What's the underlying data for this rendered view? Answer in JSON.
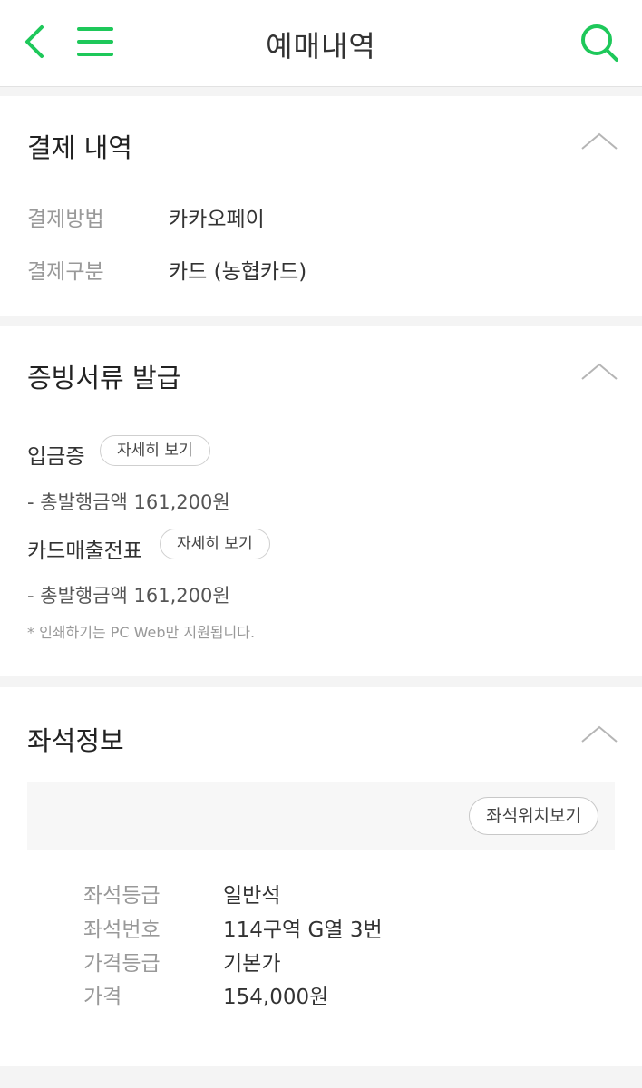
{
  "header": {
    "title": "예매내역",
    "back_icon": "chevron-left-icon",
    "menu_icon": "hamburger-menu-icon",
    "search_icon": "search-icon",
    "accent_color": "#1ec85a"
  },
  "payment": {
    "title": "결제 내역",
    "rows": [
      {
        "label": "결제방법",
        "value": "카카오페이"
      },
      {
        "label": "결제구분",
        "value": "카드 (농협카드)"
      }
    ]
  },
  "documents": {
    "title": "증빙서류 발급",
    "items": [
      {
        "label": "입금증",
        "button": "자세히 보기",
        "amount": "- 총발행금액 161,200원"
      },
      {
        "label": "카드매출전표",
        "button": "자세히 보기",
        "amount": "- 총발행금액 161,200원"
      }
    ],
    "note": "* 인쇄하기는 PC Web만 지원됩니다."
  },
  "seat": {
    "title": "좌석정보",
    "location_button": "좌석위치보기",
    "rows": [
      {
        "label": "좌석등급",
        "value": "일반석"
      },
      {
        "label": "좌석번호",
        "value": "114구역 G열 3번"
      },
      {
        "label": "가격등급",
        "value": "기본가"
      },
      {
        "label": "가격",
        "value": "154,000원"
      }
    ]
  }
}
